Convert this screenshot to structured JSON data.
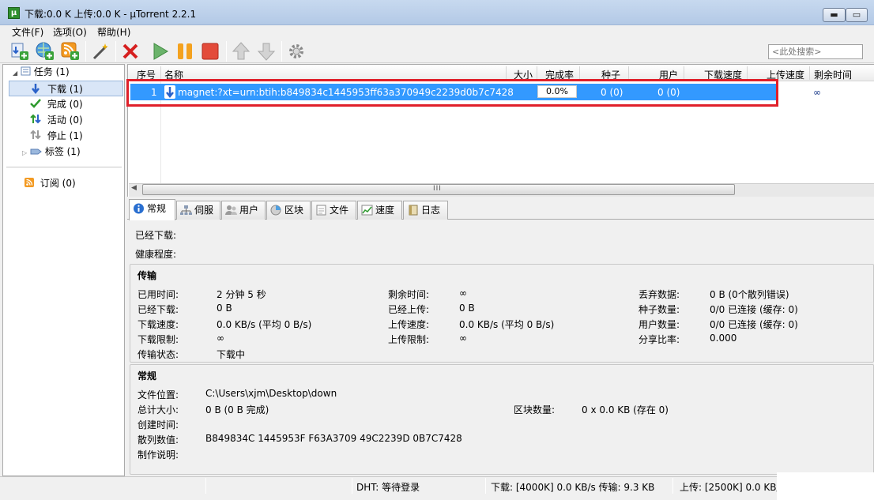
{
  "window": {
    "title": "下载:0.0 K 上传:0.0 K - µTorrent 2.2.1",
    "min_label": "▬",
    "max_label": "▭",
    "app_icon_letter": "µ"
  },
  "menu": [
    "文件(F)",
    "选项(O)",
    "帮助(H)"
  ],
  "search": {
    "placeholder": "<此处搜索>"
  },
  "sidebar": {
    "items": [
      {
        "label": "任务 (1)"
      },
      {
        "label": "下载 (1)"
      },
      {
        "label": "完成 (0)"
      },
      {
        "label": "活动 (0)"
      },
      {
        "label": "停止 (1)"
      },
      {
        "label": "标签 (1)"
      },
      {
        "label": "订阅 (0)"
      }
    ]
  },
  "list": {
    "columns": [
      "序号",
      "名称",
      "大小",
      "完成率",
      "种子",
      "用户",
      "下载速度",
      "上传速度",
      "剩余时间"
    ],
    "rows": [
      {
        "index": "1",
        "name": "magnet:?xt=urn:btih:b849834c1445953ff63a370949c2239d0b7c7428",
        "size": "",
        "progress": "0.0%",
        "seeds": "0 (0)",
        "peers": "0 (0)",
        "eta": "∞"
      }
    ],
    "scroll_grip": "III"
  },
  "tabs": [
    "常规",
    "伺服",
    "用户",
    "区块",
    "文件",
    "速度",
    "日志"
  ],
  "details": {
    "top": {
      "downloaded_label": "已经下载:",
      "health_label": "健康程度:"
    },
    "transfer": {
      "title": "传输",
      "elapsed_label": "已用时间:",
      "elapsed": "2 分钟 5 秒",
      "remaining_label": "剩余时间:",
      "remaining": "∞",
      "wasted_label": "丢弃数据:",
      "wasted": "0 B (0个散列错误)",
      "downloaded_label": "已经下载:",
      "downloaded": "0 B",
      "uploaded_label": "已经上传:",
      "uploaded": "0 B",
      "seeds_label": "种子数量:",
      "seeds": "0/0 已连接 (缓存: 0)",
      "dl_speed_label": "下载速度:",
      "dl_speed": "0.0 KB/s (平均 0 B/s)",
      "ul_speed_label": "上传速度:",
      "ul_speed": "0.0 KB/s (平均 0 B/s)",
      "peers_label": "用户数量:",
      "peers": "0/0 已连接 (缓存: 0)",
      "dl_limit_label": "下载限制:",
      "dl_limit": "∞",
      "ul_limit_label": "上传限制:",
      "ul_limit": "∞",
      "ratio_label": "分享比率:",
      "ratio": "0.000",
      "status_label": "传输状态:",
      "status": "下载中"
    },
    "general": {
      "title": "常规",
      "location_label": "文件位置:",
      "location": "C:\\Users\\xjm\\Desktop\\down",
      "total_size_label": "总计大小:",
      "total_size": "0 B (0 B 完成)",
      "pieces_label": "区块数量:",
      "pieces": "0 x 0.0 KB (存在 0)",
      "created_label": "创建时间:",
      "created": "",
      "hash_label": "散列数值:",
      "hash": "B849834C 1445953F F63A3709 49C2239D 0B7C7428",
      "comment_label": "制作说明:",
      "comment": ""
    }
  },
  "statusbar": {
    "dht": "DHT: 等待登录",
    "download": "下载:  [4000K] 0.0 KB/s 传输: 9.3 KB",
    "upload": "上传:  [2500K] 0.0 KB/"
  },
  "colors": {
    "selection": "#3399ff",
    "highlight_box": "#e0202a"
  }
}
